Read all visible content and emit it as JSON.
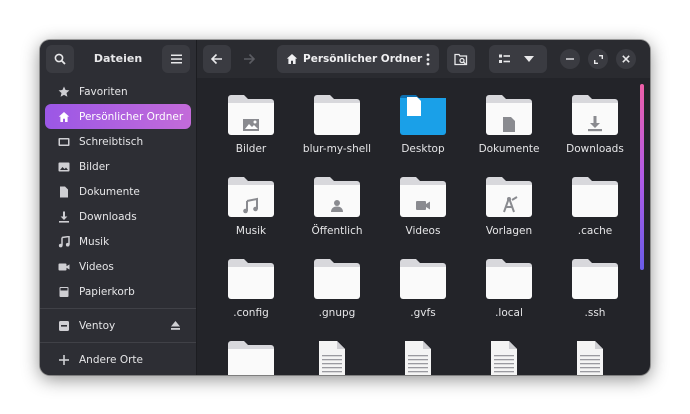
{
  "sidebar": {
    "title": "Dateien",
    "items": [
      {
        "label": "Favoriten",
        "icon": "star-icon",
        "active": false
      },
      {
        "label": "Persönlicher Ordner",
        "icon": "home-icon",
        "active": true
      },
      {
        "label": "Schreibtisch",
        "icon": "desktop-icon",
        "active": false
      },
      {
        "label": "Bilder",
        "icon": "pictures-icon",
        "active": false
      },
      {
        "label": "Dokumente",
        "icon": "document-icon",
        "active": false
      },
      {
        "label": "Downloads",
        "icon": "download-icon",
        "active": false
      },
      {
        "label": "Musik",
        "icon": "music-icon",
        "active": false
      },
      {
        "label": "Videos",
        "icon": "video-icon",
        "active": false
      },
      {
        "label": "Papierkorb",
        "icon": "trash-icon",
        "active": false
      }
    ],
    "device": {
      "label": "Ventoy",
      "icon": "drive-icon",
      "eject_icon": "eject-icon"
    },
    "other": {
      "label": "Andere Orte",
      "icon": "plus-icon"
    }
  },
  "header": {
    "path_label": "Persönlicher Ordner"
  },
  "files": [
    {
      "name": "Bilder",
      "type": "folder",
      "emblem": "image"
    },
    {
      "name": "blur-my-shell",
      "type": "folder",
      "emblem": ""
    },
    {
      "name": "Desktop",
      "type": "desktop",
      "emblem": ""
    },
    {
      "name": "Dokumente",
      "type": "folder",
      "emblem": "doc"
    },
    {
      "name": "Downloads",
      "type": "folder",
      "emblem": "download"
    },
    {
      "name": "Musik",
      "type": "folder",
      "emblem": "music"
    },
    {
      "name": "Öffentlich",
      "type": "folder",
      "emblem": "person"
    },
    {
      "name": "Videos",
      "type": "folder",
      "emblem": "video"
    },
    {
      "name": "Vorlagen",
      "type": "folder",
      "emblem": "template"
    },
    {
      "name": ".cache",
      "type": "folder",
      "emblem": ""
    },
    {
      "name": ".config",
      "type": "folder",
      "emblem": ""
    },
    {
      "name": ".gnupg",
      "type": "folder",
      "emblem": ""
    },
    {
      "name": ".gvfs",
      "type": "folder",
      "emblem": ""
    },
    {
      "name": ".local",
      "type": "folder",
      "emblem": ""
    },
    {
      "name": ".ssh",
      "type": "folder",
      "emblem": ""
    },
    {
      "name": "",
      "type": "folder",
      "emblem": ""
    },
    {
      "name": "",
      "type": "textfile",
      "emblem": ""
    },
    {
      "name": "",
      "type": "textfile",
      "emblem": ""
    },
    {
      "name": "",
      "type": "textfile",
      "emblem": ""
    },
    {
      "name": "",
      "type": "textfile",
      "emblem": ""
    }
  ],
  "colors": {
    "accent_start": "#9b57e6",
    "accent_end": "#c36bd9",
    "desktop_blue": "#1aa0e8"
  }
}
